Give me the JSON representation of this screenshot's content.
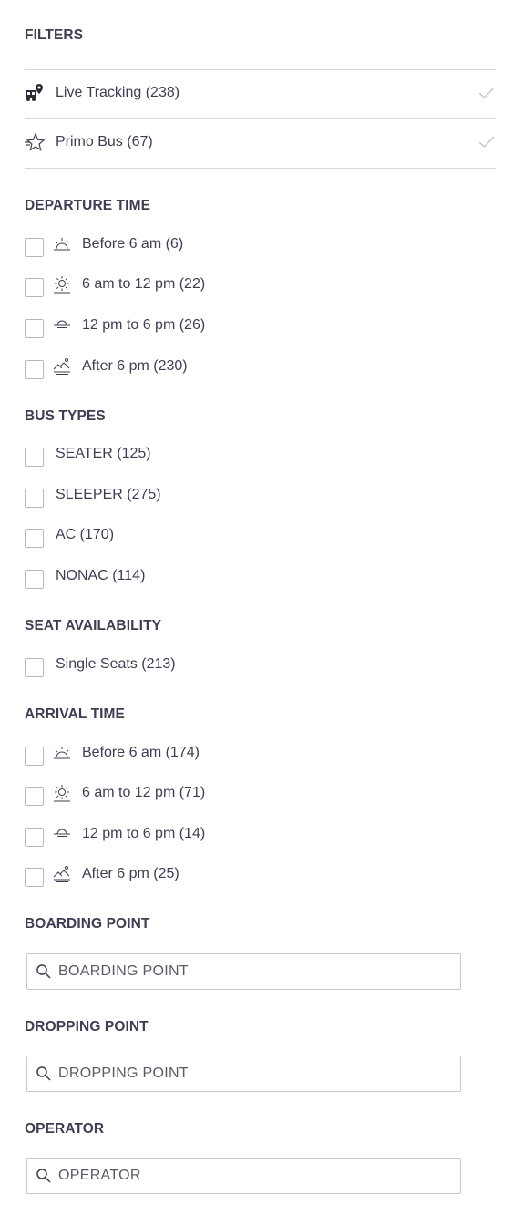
{
  "filters": {
    "title": "FILTERS",
    "toggles": [
      {
        "label": "Live Tracking (238)",
        "icon": "live-tracking-icon"
      },
      {
        "label": "Primo Bus (67)",
        "icon": "primo-star-icon"
      }
    ]
  },
  "departure_time": {
    "title": "DEPARTURE TIME",
    "options": [
      {
        "label": "Before 6 am (6)",
        "icon": "sunrise-icon"
      },
      {
        "label": "6 am to 12 pm (22)",
        "icon": "sun-icon"
      },
      {
        "label": "12 pm to 6 pm (26)",
        "icon": "sunset-icon"
      },
      {
        "label": "After 6 pm (230)",
        "icon": "night-icon"
      }
    ]
  },
  "bus_types": {
    "title": "BUS TYPES",
    "options": [
      {
        "label": "SEATER (125)"
      },
      {
        "label": "SLEEPER (275)"
      },
      {
        "label": "AC (170)"
      },
      {
        "label": "NONAC (114)"
      }
    ]
  },
  "seat_availability": {
    "title": "SEAT AVAILABILITY",
    "options": [
      {
        "label": "Single Seats (213)"
      }
    ]
  },
  "arrival_time": {
    "title": "ARRIVAL TIME",
    "options": [
      {
        "label": "Before 6 am (174)",
        "icon": "sunrise-icon"
      },
      {
        "label": "6 am to 12 pm (71)",
        "icon": "sun-icon"
      },
      {
        "label": "12 pm to 6 pm (14)",
        "icon": "sunset-icon"
      },
      {
        "label": "After 6 pm (25)",
        "icon": "night-icon"
      }
    ]
  },
  "boarding_point": {
    "title": "BOARDING POINT",
    "placeholder": "BOARDING POINT"
  },
  "dropping_point": {
    "title": "DROPPING POINT",
    "placeholder": "DROPPING POINT"
  },
  "operator": {
    "title": "OPERATOR",
    "placeholder": "OPERATOR"
  },
  "colors": {
    "text": "#3e3e52",
    "border": "#b8b8c0",
    "divider": "#d7d7dc",
    "check": "#c8c8cf"
  }
}
